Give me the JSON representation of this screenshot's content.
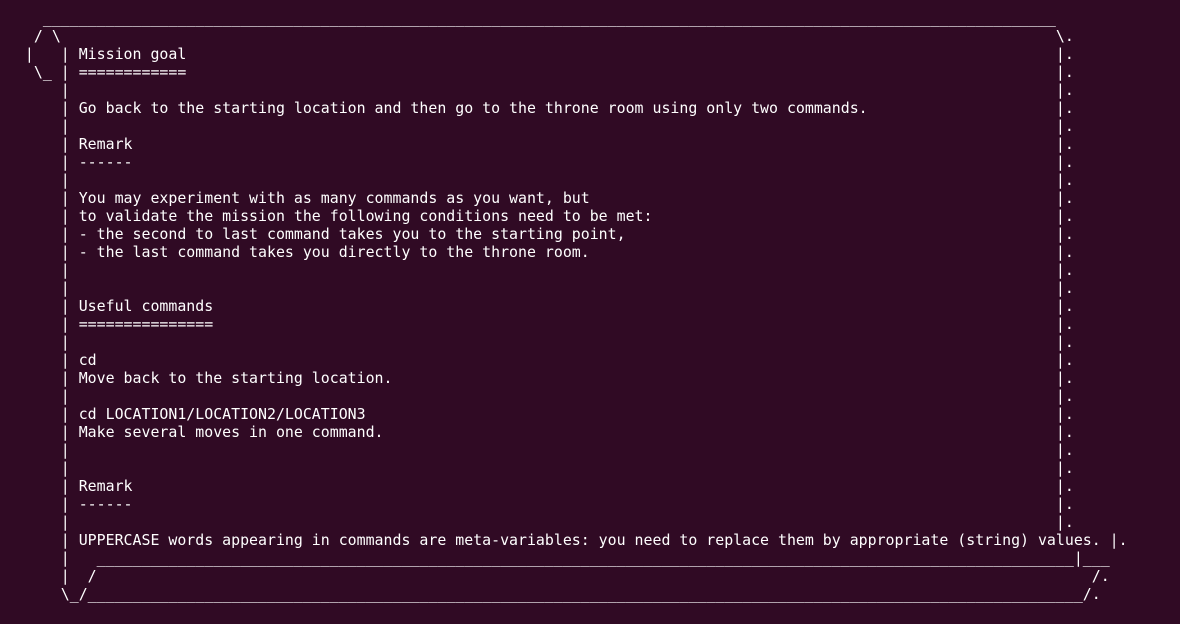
{
  "terminal": {
    "lines": [
      "    _________________________________________________________________________________________________________________",
      "   / \\                                                                                                               \\.",
      "  |   | Mission goal                                                                                                 |.",
      "   \\_ | ============                                                                                                 |.",
      "      |                                                                                                              |.",
      "      | Go back to the starting location and then go to the throne room using only two commands.                     |.",
      "      |                                                                                                              |.",
      "      | Remark                                                                                                       |.",
      "      | ------                                                                                                       |.",
      "      |                                                                                                              |.",
      "      | You may experiment with as many commands as you want, but                                                    |.",
      "      | to validate the mission the following conditions need to be met:                                             |.",
      "      | - the second to last command takes you to the starting point,                                                |.",
      "      | - the last command takes you directly to the throne room.                                                    |.",
      "      |                                                                                                              |.",
      "      |                                                                                                              |.",
      "      | Useful commands                                                                                              |.",
      "      | ===============                                                                                              |.",
      "      |                                                                                                              |.",
      "      | cd                                                                                                           |.",
      "      | Move back to the starting location.                                                                          |.",
      "      |                                                                                                              |.",
      "      | cd LOCATION1/LOCATION2/LOCATION3                                                                             |.",
      "      | Make several moves in one command.                                                                           |.",
      "      |                                                                                                              |.",
      "      |                                                                                                              |.",
      "      | Remark                                                                                                       |.",
      "      | ------                                                                                                       |.",
      "      |                                                                                                              |.",
      "      | UPPERCASE words appearing in commands are meta-variables: you need to replace them by appropriate (string) values. |.",
      "      |   _____________________________________________________________________________________________________________|___",
      "      |  /                                                                                                               /.",
      "      \\_/_______________________________________________________________________________________________________________/."
    ]
  }
}
